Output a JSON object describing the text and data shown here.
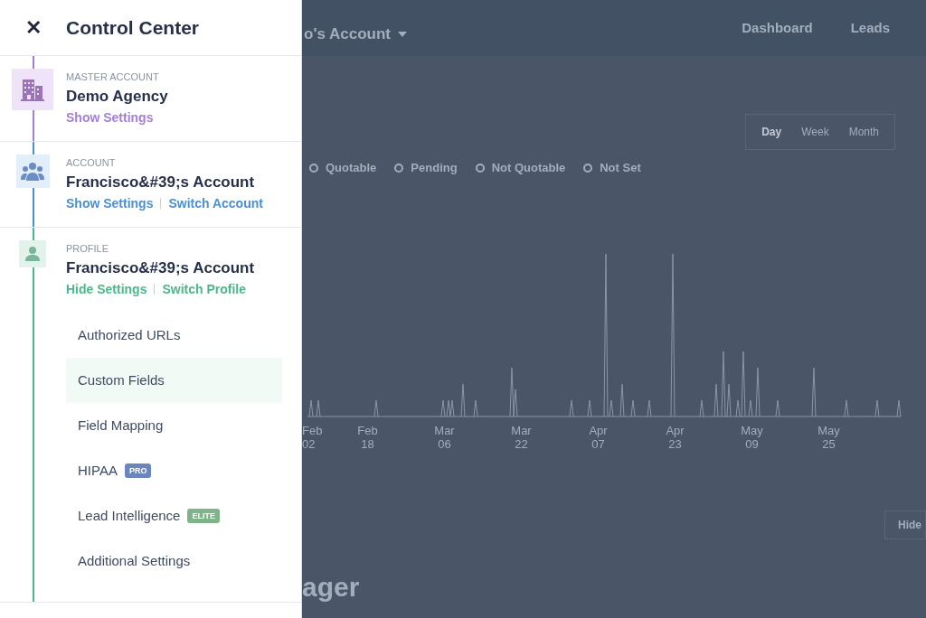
{
  "panel": {
    "close_icon": "✕",
    "title": "Control Center",
    "sections": [
      {
        "kind": "building",
        "label": "MASTER ACCOUNT",
        "name": "Demo Agency",
        "color": "#a47fd9",
        "links": [
          "Show Settings"
        ]
      },
      {
        "kind": "group",
        "label": "ACCOUNT",
        "name": "Francisco&#39;s Account",
        "color": "#4a90d2",
        "links": [
          "Show Settings",
          "Switch Account"
        ]
      },
      {
        "kind": "person",
        "label": "PROFILE",
        "name": "Francisco&#39;s Account",
        "color": "#4cb888",
        "links": [
          "Hide Settings",
          "Switch Profile"
        ]
      }
    ],
    "menu": [
      {
        "label": "Authorized URLs",
        "selected": false
      },
      {
        "label": "Custom Fields",
        "selected": true
      },
      {
        "label": "Field Mapping",
        "selected": false
      },
      {
        "label": "HIPAA",
        "selected": false,
        "badge": {
          "text": "PRO",
          "color": "#6b86bf"
        }
      },
      {
        "label": "Lead Intelligence",
        "selected": false,
        "badge": {
          "text": "ELITE",
          "color": "#7fb48a"
        }
      },
      {
        "label": "Additional Settings",
        "selected": false
      }
    ]
  },
  "background": {
    "account": "o's Account",
    "nav": [
      "Dashboard",
      "Leads"
    ],
    "range_tabs": [
      {
        "label": "Day",
        "selected": true
      },
      {
        "label": "Week",
        "selected": false
      },
      {
        "label": "Month",
        "selected": false
      }
    ],
    "legend": [
      {
        "label": "Quotable"
      },
      {
        "label": "Pending"
      },
      {
        "label": "Not Quotable"
      },
      {
        "label": "Not Set"
      }
    ],
    "x_labels": [
      {
        "month": "Feb",
        "day": "02"
      },
      {
        "month": "Feb",
        "day": "18"
      },
      {
        "month": "Mar",
        "day": "06"
      },
      {
        "month": "Mar",
        "day": "22"
      },
      {
        "month": "Apr",
        "day": "07"
      },
      {
        "month": "Apr",
        "day": "23"
      },
      {
        "month": "May",
        "day": "09"
      },
      {
        "month": "May",
        "day": "25"
      }
    ],
    "hide_button": "Hide",
    "heading": "ager"
  }
}
